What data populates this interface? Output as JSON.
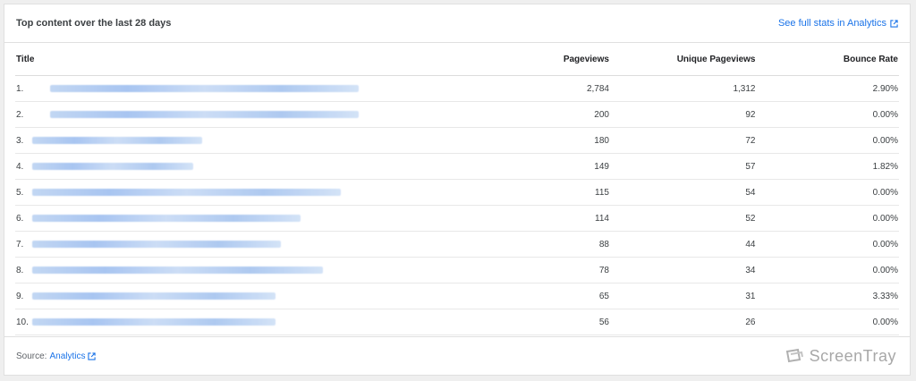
{
  "header": {
    "title": "Top content over the last 28 days",
    "stats_link": "See full stats in Analytics",
    "link_icon": "external-link-icon"
  },
  "table": {
    "columns": [
      "Title",
      "Pageviews",
      "Unique Pageviews",
      "Bounce Rate"
    ],
    "rows": [
      {
        "rank": "1.",
        "pageviews": "2,784",
        "unique": "1,312",
        "bounce": "2.90%"
      },
      {
        "rank": "2.",
        "pageviews": "200",
        "unique": "92",
        "bounce": "0.00%"
      },
      {
        "rank": "3.",
        "pageviews": "180",
        "unique": "72",
        "bounce": "0.00%"
      },
      {
        "rank": "4.",
        "pageviews": "149",
        "unique": "57",
        "bounce": "1.82%"
      },
      {
        "rank": "5.",
        "pageviews": "115",
        "unique": "54",
        "bounce": "0.00%"
      },
      {
        "rank": "6.",
        "pageviews": "114",
        "unique": "52",
        "bounce": "0.00%"
      },
      {
        "rank": "7.",
        "pageviews": "88",
        "unique": "44",
        "bounce": "0.00%"
      },
      {
        "rank": "8.",
        "pageviews": "78",
        "unique": "34",
        "bounce": "0.00%"
      },
      {
        "rank": "9.",
        "pageviews": "65",
        "unique": "31",
        "bounce": "3.33%"
      },
      {
        "rank": "10.",
        "pageviews": "56",
        "unique": "26",
        "bounce": "0.00%"
      }
    ]
  },
  "footer": {
    "source_label": "Source:",
    "source_link": "Analytics",
    "watermark": "ScreenTray"
  },
  "colors": {
    "link": "#1a73e8",
    "blurred_title": "#a6c4ef"
  }
}
